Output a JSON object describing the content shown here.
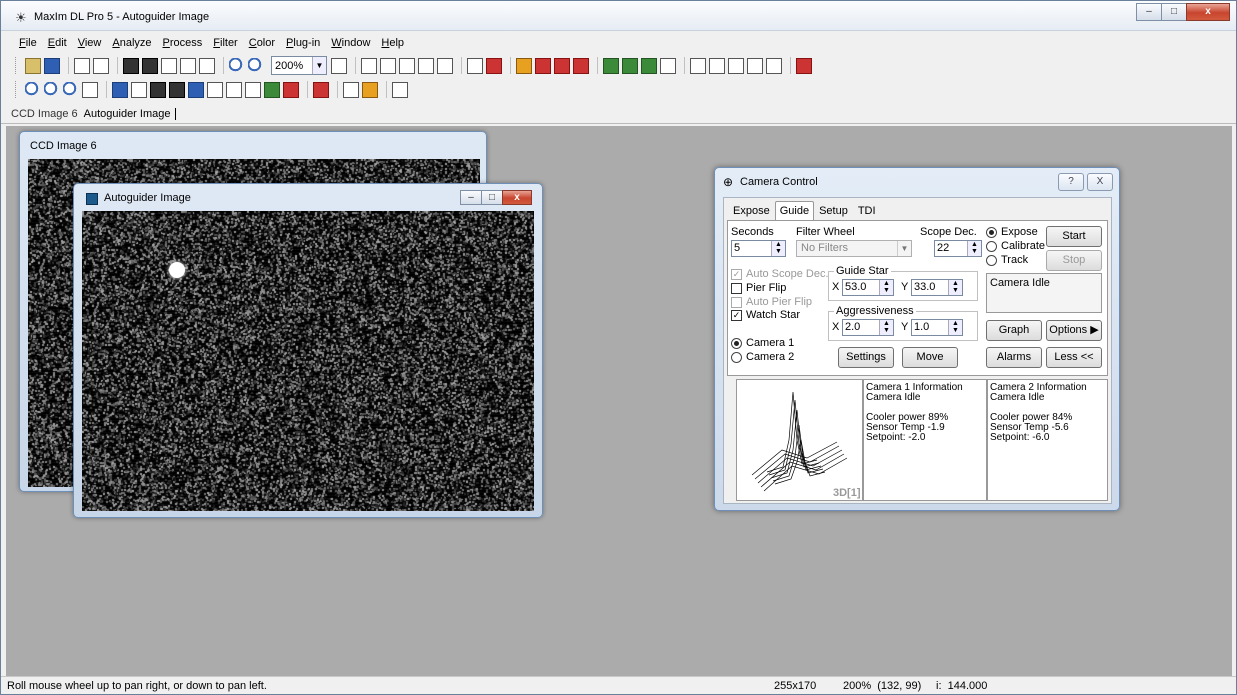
{
  "window": {
    "title": "MaxIm DL Pro 5 - Autoguider Image",
    "minimize": "–",
    "maximize": "□",
    "close": "x"
  },
  "menu": [
    "File",
    "Edit",
    "View",
    "Analyze",
    "Process",
    "Filter",
    "Color",
    "Plug-in",
    "Window",
    "Help"
  ],
  "toolbar": {
    "zoom_value": "200%"
  },
  "doc_tabs": [
    "CCD Image 6",
    "Autoguider Image"
  ],
  "ccd_window": {
    "title": "CCD Image 6"
  },
  "autoguider_window": {
    "title": "Autoguider Image"
  },
  "camera_control": {
    "title": "Camera Control",
    "help": "?",
    "close": "X",
    "tabs": [
      "Expose",
      "Guide",
      "Setup",
      "TDI"
    ],
    "selected_tab": "Guide",
    "seconds_label": "Seconds",
    "seconds_value": "5",
    "filter_wheel_label": "Filter Wheel",
    "filter_wheel_value": "No Filters",
    "scope_dec_label": "Scope Dec.",
    "scope_dec_value": "22",
    "mode_expose": "Expose",
    "mode_calibrate": "Calibrate",
    "mode_track": "Track",
    "start": "Start",
    "stop": "Stop",
    "status": "Camera Idle",
    "auto_scope_dec": "Auto Scope Dec.",
    "pier_flip": "Pier Flip",
    "auto_pier_flip": "Auto Pier Flip",
    "watch_star": "Watch Star",
    "guide_star_label": "Guide Star",
    "guide_x_label": "X",
    "guide_x": "53.0",
    "guide_y_label": "Y",
    "guide_y": "33.0",
    "aggressiveness_label": "Aggressiveness",
    "aggr_x_label": "X",
    "aggr_x": "2.0",
    "aggr_y_label": "Y",
    "aggr_y": "1.0",
    "camera1": "Camera 1",
    "camera2": "Camera 2",
    "settings": "Settings",
    "move": "Move",
    "graph": "Graph",
    "options": "Options",
    "options_arrow": "▶",
    "alarms": "Alarms",
    "less": "Less <<",
    "plot_label": "3D[1]",
    "cam1_info": [
      "Camera 1 Information",
      "Camera Idle",
      "",
      "Cooler power 89%",
      "Sensor Temp -1.9",
      "Setpoint: -2.0"
    ],
    "cam2_info": [
      "Camera 2 Information",
      "Camera Idle",
      "",
      "Cooler power 84%",
      "Sensor Temp -5.6",
      "Setpoint: -6.0"
    ]
  },
  "status_bar": {
    "message": "Roll mouse wheel up to pan right, or down to pan left.",
    "image_size": "255x170",
    "zoom_coords": "200%  (132, 99)",
    "pixel_value": "i:  144.000"
  }
}
